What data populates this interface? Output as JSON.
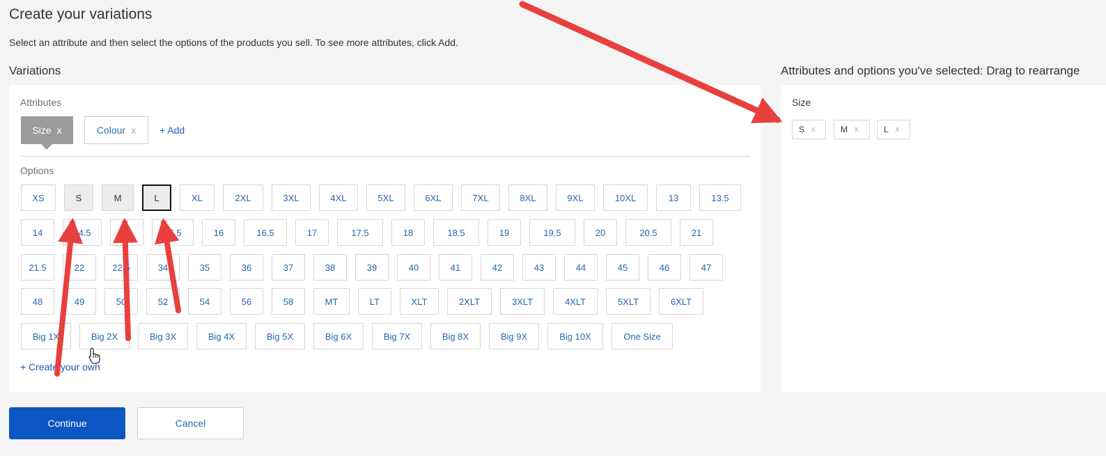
{
  "page": {
    "title": "Create your variations",
    "subtitle": "Select an attribute and then select the options of the products you sell. To see more attributes, click Add."
  },
  "variations": {
    "heading": "Variations",
    "attributes_label": "Attributes",
    "attributes": [
      {
        "label": "Size",
        "remove": "x",
        "active": true
      },
      {
        "label": "Colour",
        "remove": "x",
        "active": false
      }
    ],
    "add_label": "+ Add",
    "options_label": "Options",
    "option_rows": [
      [
        "XS",
        "S",
        "M",
        "L",
        "XL",
        "2XL",
        "3XL",
        "4XL",
        "5XL",
        "6XL",
        "7XL",
        "8XL",
        "9XL",
        "10XL",
        "13",
        "13.5"
      ],
      [
        "14",
        "14.5",
        "15",
        "15.5",
        "16",
        "16.5",
        "17",
        "17.5",
        "18",
        "18.5",
        "19",
        "19.5",
        "20",
        "20.5",
        "21"
      ],
      [
        "21.5",
        "22",
        "22.5",
        "34",
        "35",
        "36",
        "37",
        "38",
        "39",
        "40",
        "41",
        "42",
        "43",
        "44",
        "45",
        "46",
        "47"
      ],
      [
        "48",
        "49",
        "50",
        "52",
        "54",
        "56",
        "58",
        "MT",
        "LT",
        "XLT",
        "2XLT",
        "3XLT",
        "4XLT",
        "5XLT",
        "6XLT"
      ],
      [
        "Big 1X",
        "Big 2X",
        "Big 3X",
        "Big 4X",
        "Big 5X",
        "Big 6X",
        "Big 7X",
        "Big 8X",
        "Big 9X",
        "Big 10X",
        "One Size"
      ]
    ],
    "selected_options": [
      "S",
      "M",
      "L"
    ],
    "focused_option": "L",
    "create_own_label": "+ Create your own"
  },
  "selected_panel": {
    "heading": "Attributes and options you've selected: Drag to rearrange",
    "attribute_label": "Size",
    "chips": [
      {
        "label": "S",
        "remove": "x"
      },
      {
        "label": "M",
        "remove": "x"
      },
      {
        "label": "L",
        "remove": "x"
      }
    ]
  },
  "actions": {
    "continue_label": "Continue",
    "cancel_label": "Cancel"
  },
  "colors": {
    "accent": "#0b56c2",
    "link": "#2866b1",
    "annotation_arrow": "#e8403f"
  },
  "icons": [
    "hand-pointer-icon",
    "annotation-arrow"
  ]
}
